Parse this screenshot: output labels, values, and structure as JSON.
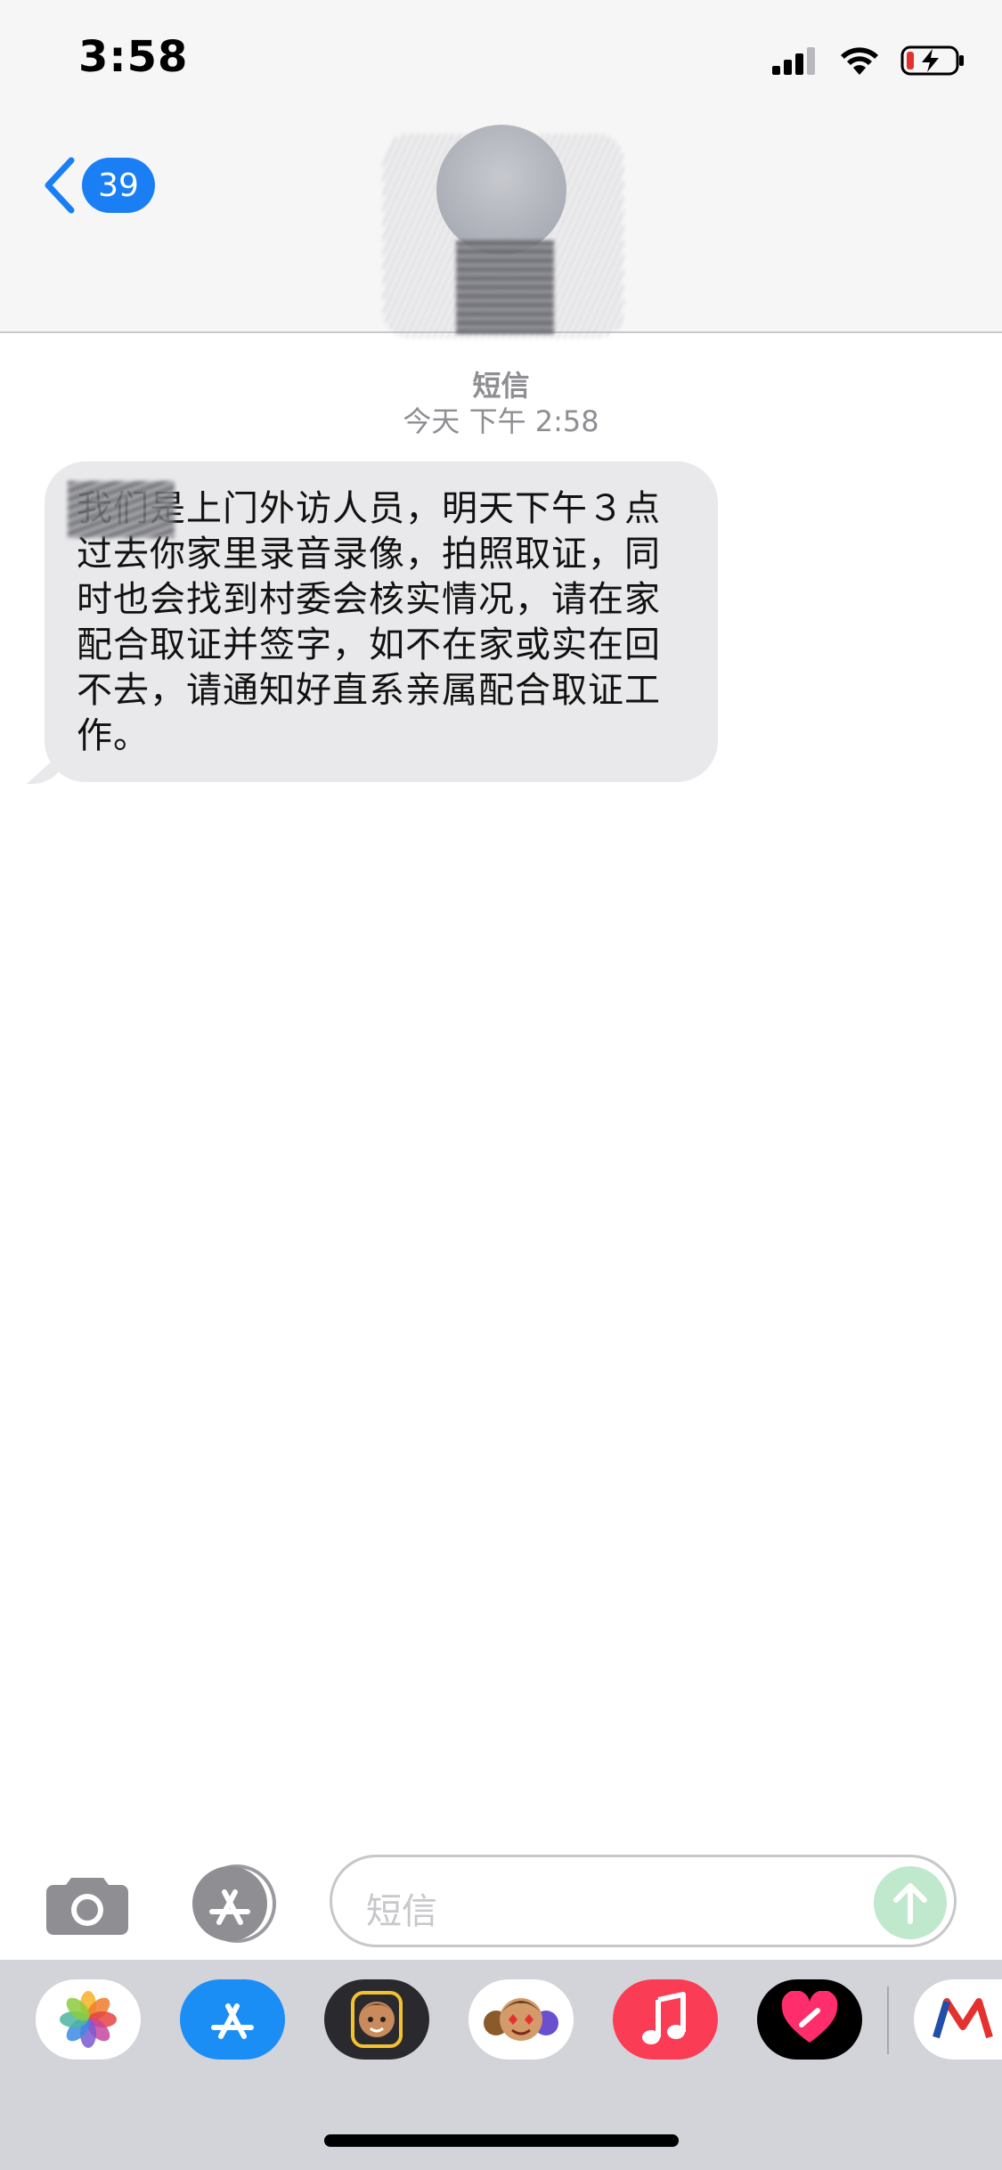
{
  "status_bar": {
    "time": "3:58"
  },
  "nav": {
    "back_count": "39"
  },
  "thread": {
    "service": "短信",
    "timestamp": "今天 下午 2:58",
    "message": "我们是上门外访人员，明天下午３点过去你家里录音录像，拍照取证，同时也会找到村委会核实情况，请在家配合取证并签字，如不在家或实在回不去，请通知好直系亲属配合取证工作。"
  },
  "composer": {
    "placeholder": "短信"
  },
  "dock": {
    "apps": [
      "photos-icon",
      "app-store-icon",
      "memoji-icon",
      "memoji-stickers-icon",
      "music-icon",
      "digital-touch-icon",
      "more-app-icon"
    ]
  },
  "colors": {
    "accent": "#1a7ef5",
    "bubble": "#e9e9eb",
    "send": "#bfe8cc",
    "music": "#fa3d55"
  }
}
